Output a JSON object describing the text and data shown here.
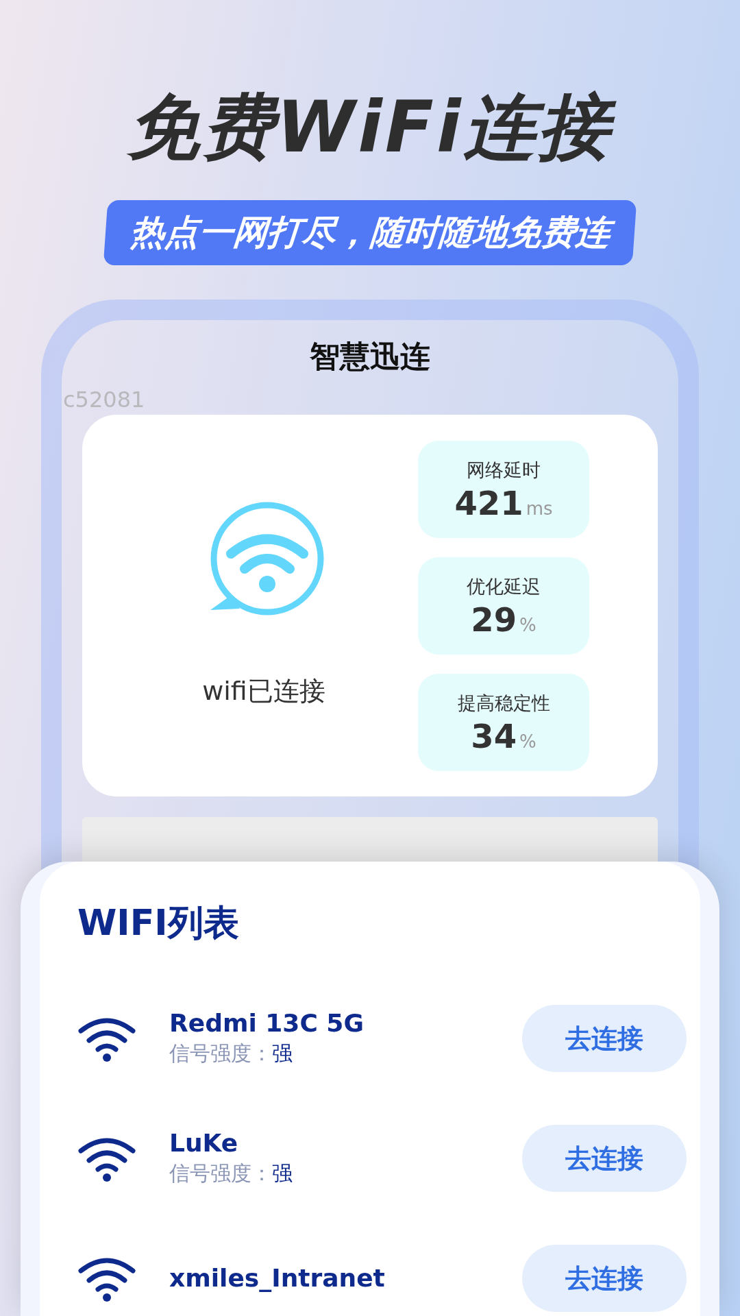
{
  "headline": "免费WiFi连接",
  "banner": "热点一网打尽，随时随地免费连",
  "app": {
    "title": "智慧迅连",
    "code": "c52081",
    "status": "wifi已连接",
    "stats": [
      {
        "label": "网络延时",
        "value": "421",
        "unit": "ms"
      },
      {
        "label": "优化延迟",
        "value": "29",
        "unit": "%"
      },
      {
        "label": "提高稳定性",
        "value": "34",
        "unit": "%"
      }
    ]
  },
  "wifi_list": {
    "title": "WIFI列表",
    "networks": [
      {
        "name": "Redmi 13C 5G",
        "signal_label": "信号强度：",
        "signal_value": "强",
        "button": "去连接"
      },
      {
        "name": "LuKe",
        "signal_label": "信号强度：",
        "signal_value": "强",
        "button": "去连接"
      },
      {
        "name": "xmiles_Intranet",
        "button": "去连接"
      }
    ]
  }
}
